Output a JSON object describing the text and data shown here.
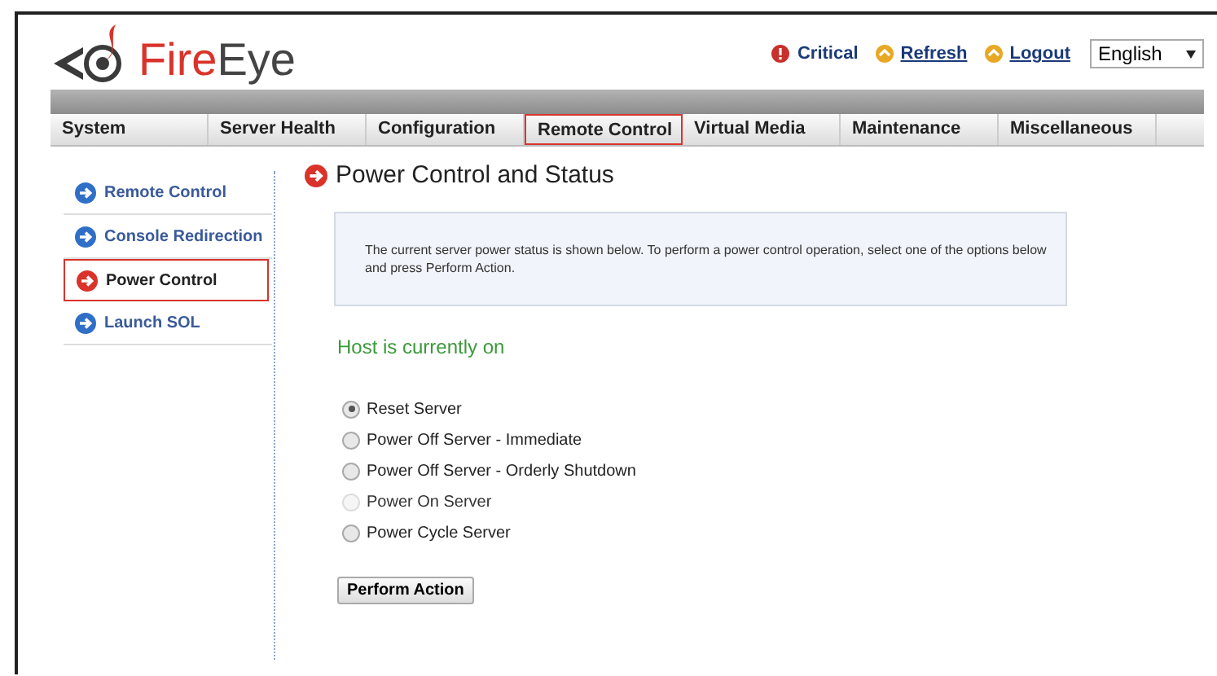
{
  "logo": {
    "part_1": "Fire",
    "part_2": "Eye"
  },
  "top_links": [
    {
      "kind": "status",
      "label": "Critical"
    },
    {
      "kind": "link",
      "label": "Refresh"
    },
    {
      "kind": "link",
      "label": "Logout"
    }
  ],
  "language": {
    "value": "English"
  },
  "tabs": [
    {
      "label": "System",
      "selected": false
    },
    {
      "label": "Server Health",
      "selected": false
    },
    {
      "label": "Configuration",
      "selected": false
    },
    {
      "label": "Remote Control",
      "selected": true
    },
    {
      "label": "Virtual Media",
      "selected": false
    },
    {
      "label": "Maintenance",
      "selected": false
    },
    {
      "label": "Miscellaneous",
      "selected": false
    }
  ],
  "sidebar": {
    "items": [
      {
        "label": "Remote Control",
        "selected": false
      },
      {
        "label": "Console Redirection",
        "selected": false
      },
      {
        "label": "Power Control",
        "selected": true
      },
      {
        "label": "Launch SOL",
        "selected": false
      }
    ]
  },
  "page": {
    "title": "Power Control and Status",
    "info": "The current server power status is shown below. To perform a power control operation, select one of the options below and press Perform Action.",
    "status": "Host is currently on",
    "options": [
      {
        "label": "Reset Server",
        "selected": true,
        "disabled": false
      },
      {
        "label": "Power Off Server - Immediate",
        "selected": false,
        "disabled": false
      },
      {
        "label": "Power Off Server - Orderly Shutdown",
        "selected": false,
        "disabled": false
      },
      {
        "label": "Power On Server",
        "selected": false,
        "disabled": true
      },
      {
        "label": "Power Cycle Server",
        "selected": false,
        "disabled": false
      }
    ],
    "button": "Perform Action"
  }
}
